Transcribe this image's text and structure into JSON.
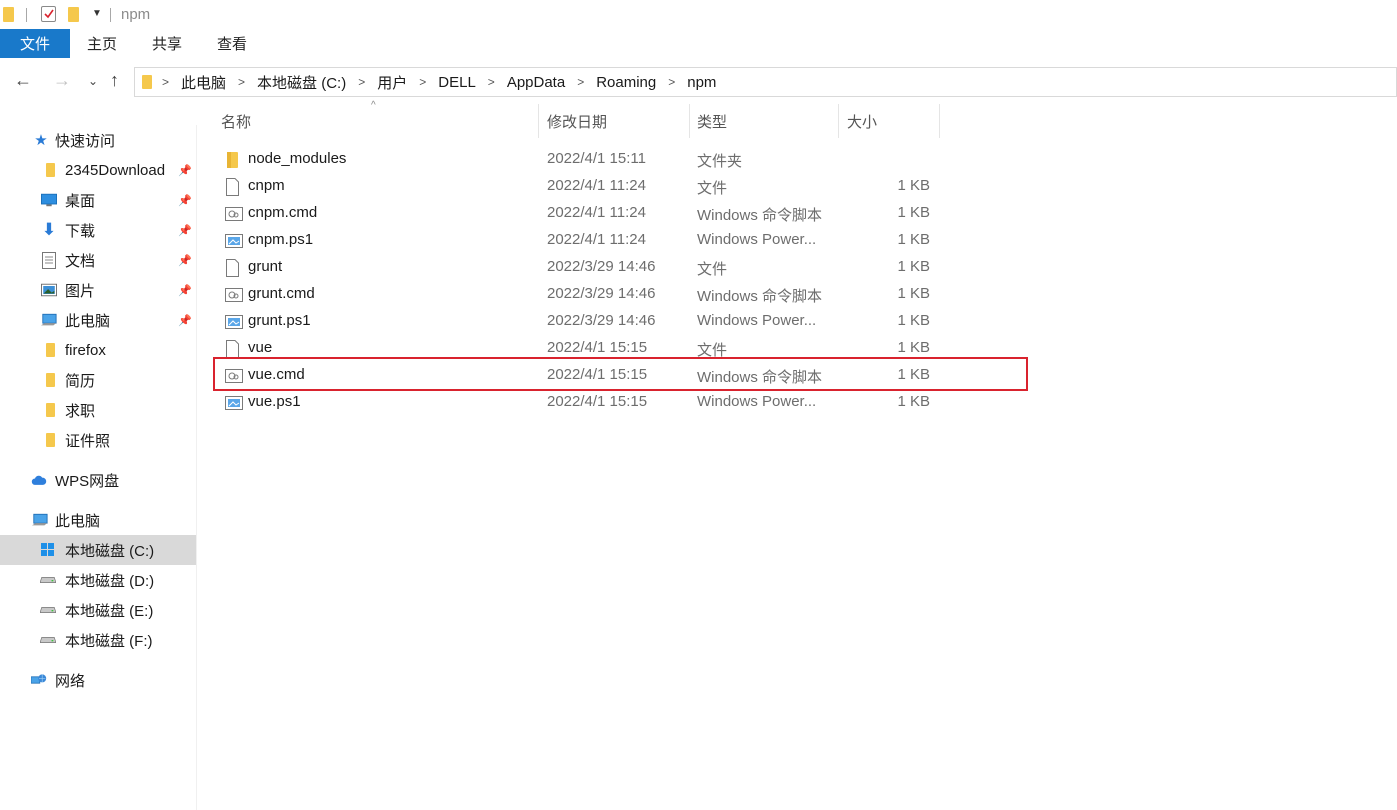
{
  "window": {
    "title": "npm"
  },
  "ribbon": {
    "tabs": [
      "文件",
      "主页",
      "共享",
      "查看"
    ]
  },
  "address": {
    "crumbs": [
      "此电脑",
      "本地磁盘 (C:)",
      "用户",
      "DELL",
      "AppData",
      "Roaming",
      "npm"
    ]
  },
  "sidebar": {
    "quick_access": "快速访问",
    "pinned": [
      {
        "label": "2345Download",
        "icon": "folder-icon",
        "pinned": true
      },
      {
        "label": "桌面",
        "icon": "desktop-icon",
        "pinned": true
      },
      {
        "label": "下载",
        "icon": "download-icon",
        "pinned": true
      },
      {
        "label": "文档",
        "icon": "document-icon",
        "pinned": true
      },
      {
        "label": "图片",
        "icon": "pictures-icon",
        "pinned": true
      },
      {
        "label": "此电脑",
        "icon": "computer-icon",
        "pinned": true
      },
      {
        "label": "firefox",
        "icon": "folder-icon",
        "pinned": false
      },
      {
        "label": "简历",
        "icon": "folder-icon",
        "pinned": false
      },
      {
        "label": "求职",
        "icon": "folder-icon",
        "pinned": false
      },
      {
        "label": "证件照",
        "icon": "folder-icon",
        "pinned": false
      }
    ],
    "wps": "WPS网盘",
    "this_pc": "此电脑",
    "drives": [
      "本地磁盘 (C:)",
      "本地磁盘 (D:)",
      "本地磁盘 (E:)",
      "本地磁盘 (F:)"
    ],
    "network": "网络"
  },
  "columns": {
    "name": "名称",
    "date": "修改日期",
    "type": "类型",
    "size": "大小"
  },
  "files": [
    {
      "name": "node_modules",
      "date": "2022/4/1 15:11",
      "type": "文件夹",
      "size": "",
      "icon": "folder-icon"
    },
    {
      "name": "cnpm",
      "date": "2022/4/1 11:24",
      "type": "文件",
      "size": "1 KB",
      "icon": "file-icon"
    },
    {
      "name": "cnpm.cmd",
      "date": "2022/4/1 11:24",
      "type": "Windows 命令脚本",
      "size": "1 KB",
      "icon": "cmd-file-icon"
    },
    {
      "name": "cnpm.ps1",
      "date": "2022/4/1 11:24",
      "type": "Windows Power...",
      "size": "1 KB",
      "icon": "ps1-file-icon"
    },
    {
      "name": "grunt",
      "date": "2022/3/29 14:46",
      "type": "文件",
      "size": "1 KB",
      "icon": "file-icon"
    },
    {
      "name": "grunt.cmd",
      "date": "2022/3/29 14:46",
      "type": "Windows 命令脚本",
      "size": "1 KB",
      "icon": "cmd-file-icon"
    },
    {
      "name": "grunt.ps1",
      "date": "2022/3/29 14:46",
      "type": "Windows Power...",
      "size": "1 KB",
      "icon": "ps1-file-icon"
    },
    {
      "name": "vue",
      "date": "2022/4/1 15:15",
      "type": "文件",
      "size": "1 KB",
      "icon": "file-icon"
    },
    {
      "name": "vue.cmd",
      "date": "2022/4/1 15:15",
      "type": "Windows 命令脚本",
      "size": "1 KB",
      "icon": "cmd-file-icon"
    },
    {
      "name": "vue.ps1",
      "date": "2022/4/1 15:15",
      "type": "Windows Power...",
      "size": "1 KB",
      "icon": "ps1-file-icon"
    }
  ],
  "colors": {
    "accent": "#1979ca",
    "highlight": "#d9232e",
    "folder": "#f5c84c"
  }
}
